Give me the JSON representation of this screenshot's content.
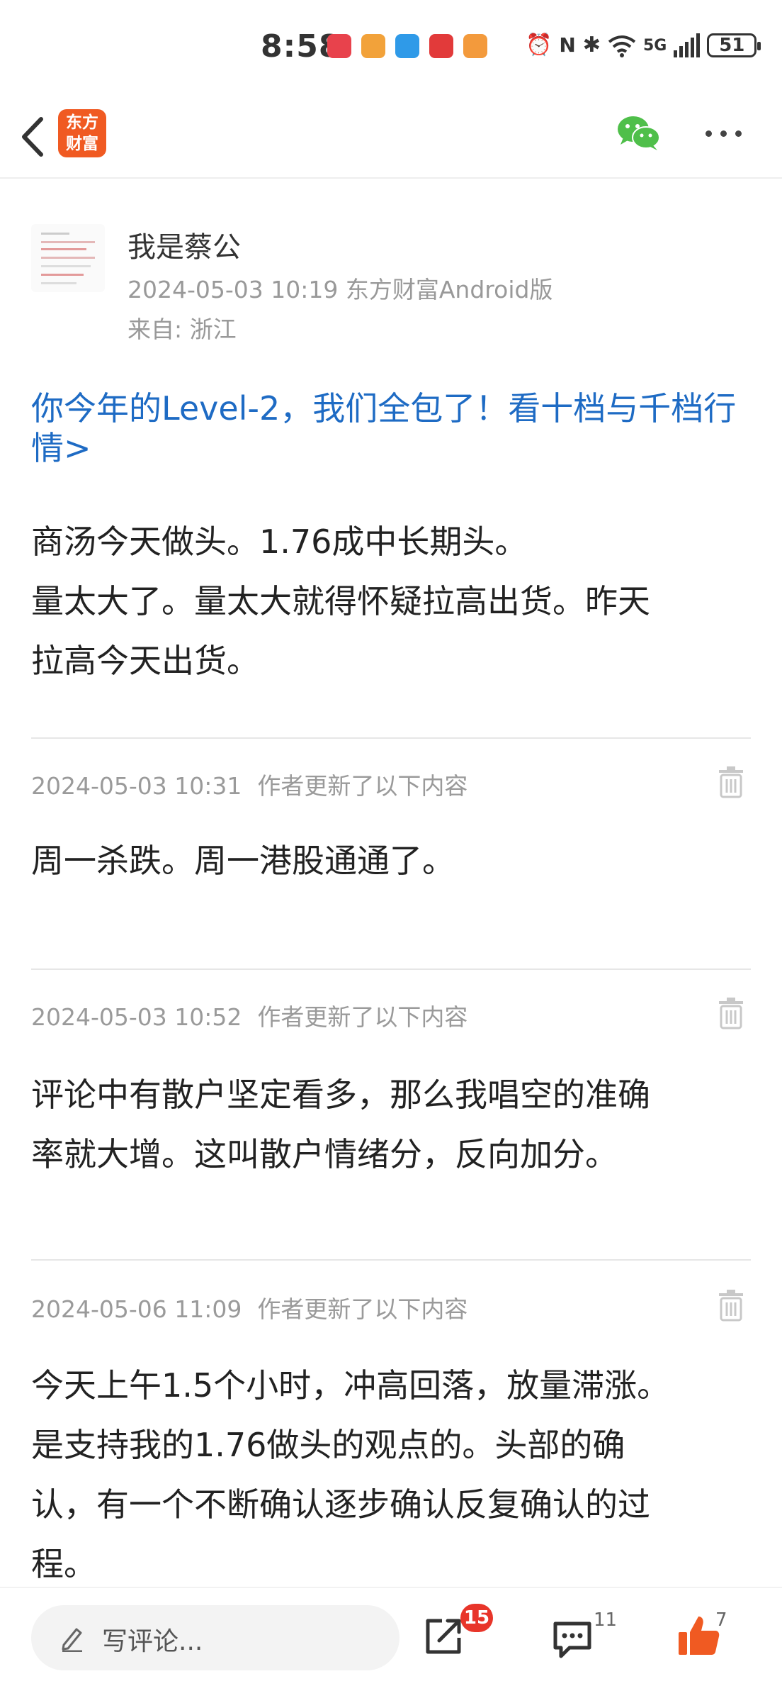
{
  "status_bar": {
    "time": "8:58",
    "network": "5G",
    "battery": "51",
    "app_icons": [
      {
        "name": "huawei-app-icon",
        "color": "#e8424c"
      },
      {
        "name": "weibo-icon",
        "color": "#f2a23a"
      },
      {
        "name": "message-app-icon",
        "color": "#2f9ae8"
      },
      {
        "name": "red-app-icon",
        "color": "#e23a3a"
      },
      {
        "name": "orange-app-icon",
        "color": "#f39a3c"
      }
    ]
  },
  "header": {
    "logo_line1": "东方",
    "logo_line2": "财富",
    "brand_color": "#f05a22",
    "wechat_color": "#4fbf4a"
  },
  "author": {
    "name": "我是蔡公",
    "meta": "2024-05-03 10:19 东方财富Android版",
    "location": "来自: 浙江"
  },
  "promo": {
    "text": "你今年的Level-2，我们全包了！看十档与千档行情>",
    "color": "#1e6bc4"
  },
  "post": {
    "line1": "商汤今天做头。1.76成中长期头。",
    "line2": "量太大了。量太大就得怀疑拉高出货。昨天",
    "line3": "拉高今天出货。"
  },
  "updates": [
    {
      "time": "2024-05-03 10:31",
      "label": "作者更新了以下内容",
      "lines": [
        "周一杀跌。周一港股通通了。"
      ]
    },
    {
      "time": "2024-05-03 10:52",
      "label": "作者更新了以下内容",
      "lines": [
        "评论中有散户坚定看多，那么我唱空的准确",
        "率就大增。这叫散户情绪分，反向加分。"
      ]
    },
    {
      "time": "2024-05-06 11:09",
      "label": "作者更新了以下内容",
      "lines": [
        "今天上午1.5个小时，冲高回落，放量滞涨。",
        "是支持我的1.76做头的观点的。头部的确",
        "认，有一个不断确认逐步确认反复确认的过",
        "程。"
      ]
    }
  ],
  "bottom_bar": {
    "comment_placeholder": "写评论...",
    "share_badge": "15",
    "comment_count": "11",
    "like_count": "7",
    "badge_color": "#e8352a",
    "like_color": "#f05a22"
  }
}
